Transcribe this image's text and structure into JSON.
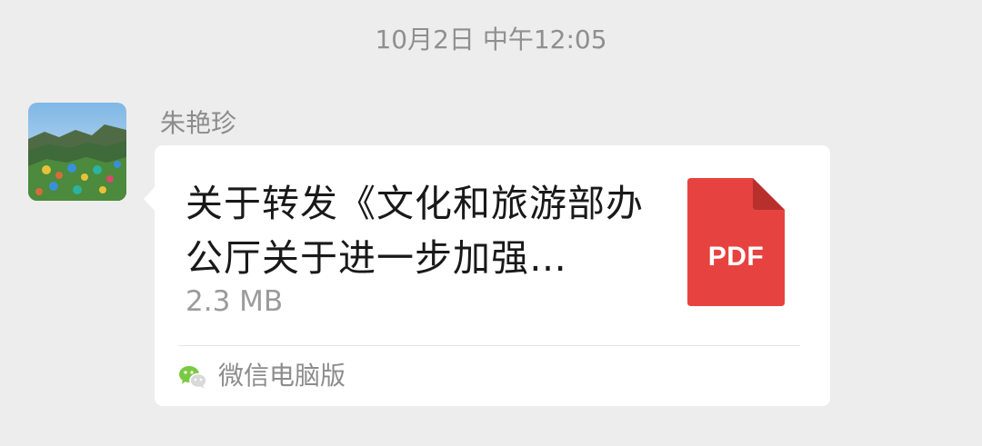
{
  "chat": {
    "timestamp": "10月2日 中午12:05",
    "message": {
      "sender_name": "朱艳珍",
      "avatar": "avatar-landscape-tents",
      "file": {
        "title": "关于转发《文化和旅游部办公厅关于进一步加强…",
        "size": "2.3 MB",
        "type_label": "PDF",
        "icon": "pdf-file-icon",
        "icon_color": "#e64340"
      },
      "source": {
        "label": "微信电脑版",
        "icon": "wechat-icon",
        "icon_color": "#7bc943"
      }
    }
  },
  "colors": {
    "background": "#ededed",
    "bubble": "#ffffff"
  }
}
